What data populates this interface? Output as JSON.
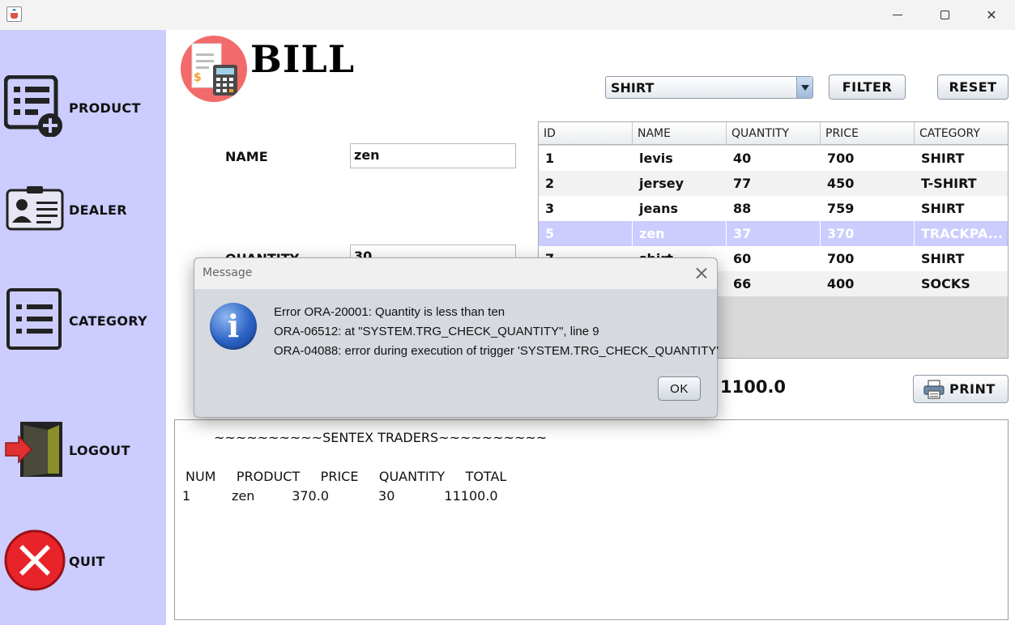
{
  "window": {
    "minimize": "",
    "maximize": "",
    "close": "✕"
  },
  "sidebar": {
    "items": [
      {
        "label": "PRODUCT",
        "icon": "product-add-icon"
      },
      {
        "label": "DEALER",
        "icon": "dealer-id-card-icon"
      },
      {
        "label": "CATEGORY",
        "icon": "category-list-icon"
      },
      {
        "label": "LOGOUT",
        "icon": "logout-door-icon"
      },
      {
        "label": "QUIT",
        "icon": "quit-x-icon"
      }
    ]
  },
  "header": {
    "title": "BILL",
    "logo_icon": "bill-receipt-calculator-icon"
  },
  "form": {
    "name_label": "NAME",
    "name_value": "zen",
    "quantity_label": "QUANTITY",
    "quantity_value": "30"
  },
  "filter": {
    "selected_category": "SHIRT",
    "filter_button": "FILTER",
    "reset_button": "RESET"
  },
  "table": {
    "columns": [
      "ID",
      "NAME",
      "QUANTITY",
      "PRICE",
      "CATEGORY"
    ],
    "rows": [
      [
        "1",
        "levis",
        "40",
        "700",
        "SHIRT"
      ],
      [
        "2",
        "jersey",
        "77",
        "450",
        "T-SHIRT"
      ],
      [
        "3",
        "jeans",
        "88",
        "759",
        "SHIRT"
      ],
      [
        "5",
        "zen",
        "37",
        "370",
        "TRACKPA..."
      ],
      [
        "7",
        "shirt",
        "60",
        "700",
        "SHIRT"
      ],
      [
        "",
        "",
        "66",
        "400",
        "SOCKS"
      ]
    ],
    "selected_row": 3
  },
  "total": {
    "value": "1100.0"
  },
  "print_button": "PRINT",
  "receipt": {
    "header": "~~~~~~~~~~SENTEX TRADERS~~~~~~~~~~",
    "columns": "NUM     PRODUCT     PRICE     QUANTITY     TOTAL",
    "line": "1          zen         370.0            30            11100.0"
  },
  "dialog": {
    "title": "Message",
    "lines": [
      "Error ORA-20001: Quantity is less than ten",
      "ORA-06512: at \"SYSTEM.TRG_CHECK_QUANTITY\", line 9",
      "ORA-04088: error during execution of trigger 'SYSTEM.TRG_CHECK_QUANTITY'"
    ],
    "ok_button": "OK"
  },
  "colors": {
    "sidebar": "#ccccff",
    "selected_row": "#ccccff",
    "logo_circle": "#f26a6a",
    "info_icon": "#2b62c4"
  }
}
